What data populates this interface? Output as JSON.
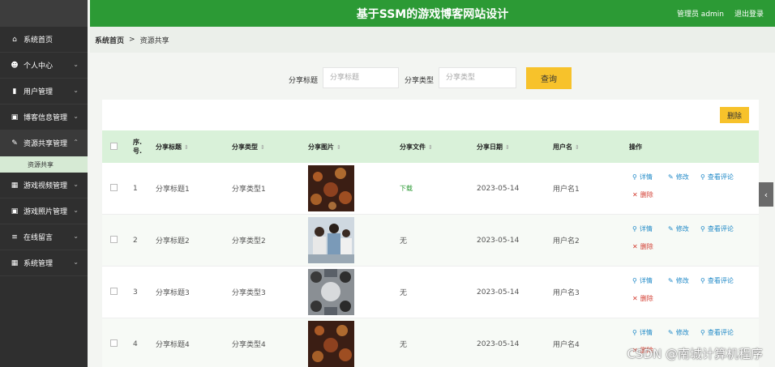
{
  "app": {
    "title": "基于SSM的游戏博客网站设计",
    "user_label": "管理员 admin",
    "logout_label": "退出登录"
  },
  "sidebar": {
    "items": [
      {
        "label": "系统首页",
        "icon": "home-icon",
        "glyph": "⌂"
      },
      {
        "label": "个人中心",
        "icon": "user-icon",
        "glyph": "☻",
        "chevron": "⌄"
      },
      {
        "label": "用户管理",
        "icon": "bar-chart-icon",
        "glyph": "▮",
        "chevron": "⌄"
      },
      {
        "label": "博客信息管理",
        "icon": "calendar-icon",
        "glyph": "▣",
        "chevron": "⌄"
      },
      {
        "label": "资源共享管理",
        "icon": "share-icon",
        "glyph": "✎",
        "chevron": "⌃"
      },
      {
        "label": "游戏视频管理",
        "icon": "grid-icon",
        "glyph": "▦",
        "chevron": "⌄"
      },
      {
        "label": "游戏照片管理",
        "icon": "calendar-icon",
        "glyph": "▣",
        "chevron": "⌄"
      },
      {
        "label": "在线留言",
        "icon": "list-icon",
        "glyph": "≡",
        "chevron": "⌄"
      },
      {
        "label": "系统管理",
        "icon": "grid-icon",
        "glyph": "▦",
        "chevron": "⌄"
      }
    ],
    "sub_item": "资源共享"
  },
  "breadcrumb": {
    "home": "系统首页",
    "separator": ">",
    "current": "资源共享"
  },
  "search": {
    "title_label": "分享标题",
    "title_placeholder": "分享标题",
    "type_label": "分享类型",
    "type_placeholder": "分享类型",
    "query_label": "查询"
  },
  "toolbar": {
    "delete_label": "删除"
  },
  "table": {
    "headers": [
      "序.号.",
      "分享标题",
      "分享类型",
      "分享图片",
      "分享文件",
      "分享日期",
      "用户名",
      "操作"
    ],
    "sort_glyph": "⇕",
    "rows": [
      {
        "no": "1",
        "title": "分享标题1",
        "type": "分享类型1",
        "file": "下载",
        "date": "2023-05-14",
        "user": "用户名1"
      },
      {
        "no": "2",
        "title": "分享标题2",
        "type": "分享类型2",
        "file": "无",
        "date": "2023-05-14",
        "user": "用户名2"
      },
      {
        "no": "3",
        "title": "分享标题3",
        "type": "分享类型3",
        "file": "无",
        "date": "2023-05-14",
        "user": "用户名3"
      },
      {
        "no": "4",
        "title": "分享标题4",
        "type": "分享类型4",
        "file": "无",
        "date": "2023-05-14",
        "user": "用户名4"
      }
    ],
    "actions": {
      "detail": "详情",
      "edit": "修改",
      "comments": "查看评论",
      "delete": "删除"
    }
  },
  "watermark": "CSDN @南城计算机程序",
  "colors": {
    "header": "#2c9a35",
    "sidebar": "#2f2f2f",
    "button": "#f7c22b",
    "link": "#1e88c7",
    "danger": "#d23b2f"
  }
}
